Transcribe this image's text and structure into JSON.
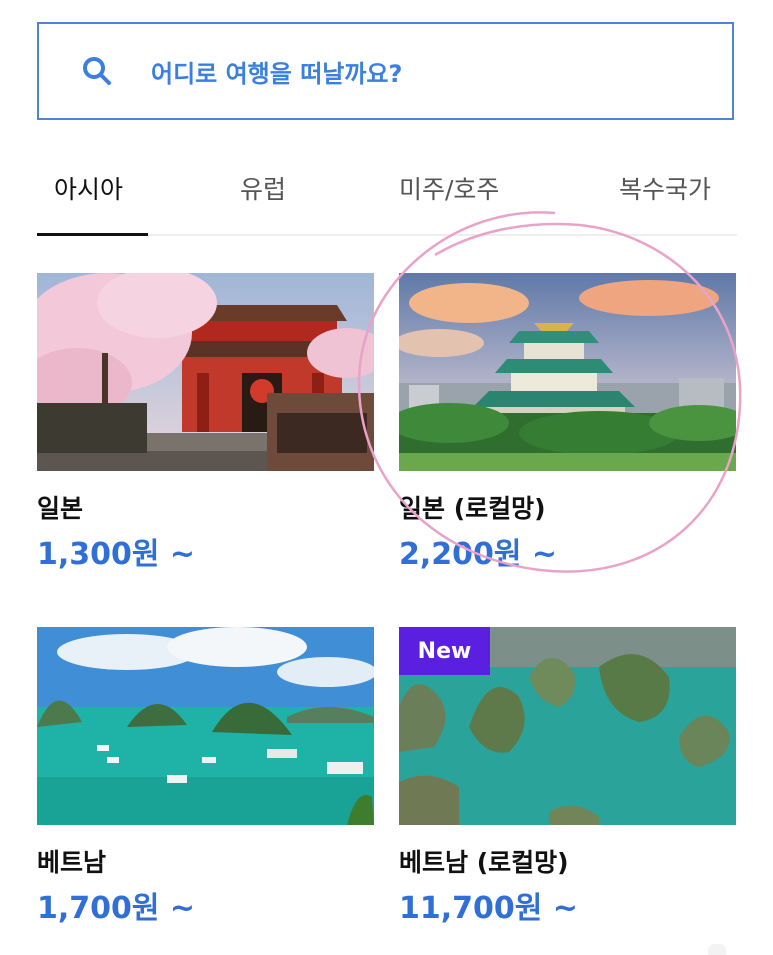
{
  "search": {
    "placeholder": "어디로 여행을 떠날까요?",
    "icon": "search-icon",
    "color": "#3b7fe0"
  },
  "tabs": [
    {
      "label": "아시아",
      "active": true
    },
    {
      "label": "유럽",
      "active": false
    },
    {
      "label": "미주/호주",
      "active": false
    },
    {
      "label": "복수국가",
      "active": false
    }
  ],
  "products": [
    {
      "name": "일본",
      "price": "1,300원 ~"
    },
    {
      "name": "일본 (로컬망)",
      "price": "2,200원 ~"
    },
    {
      "name": "베트남",
      "price": "1,700원 ~"
    },
    {
      "name": "베트남 (로컬망)",
      "price": "11,700원 ~",
      "badge": "New"
    }
  ],
  "colors": {
    "accent": "#2f6fd6",
    "badge": "#5a1fe0",
    "annotation": "#e9a3c8"
  }
}
